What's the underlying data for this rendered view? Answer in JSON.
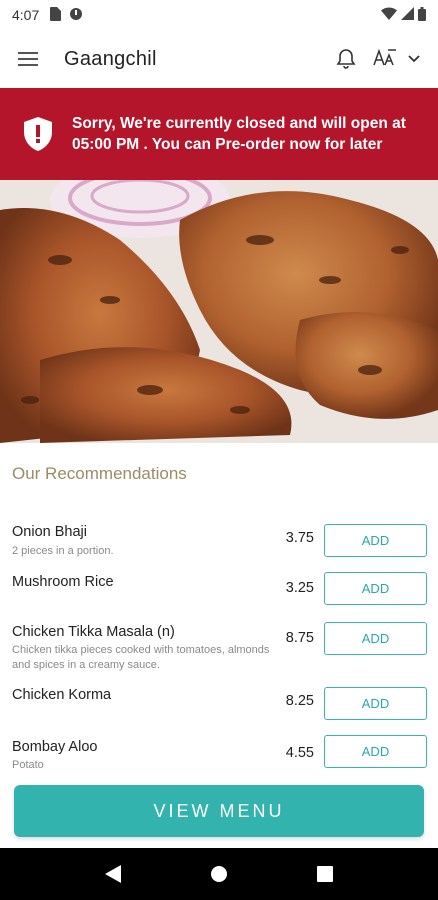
{
  "status_bar": {
    "time": "4:07"
  },
  "app_bar": {
    "title": "Gaangchil"
  },
  "banner": {
    "message": "Sorry, We're currently closed and will open at 05:00 PM . You can Pre-order now for later"
  },
  "recommendations": {
    "title": "Our Recommendations",
    "add_label": "ADD",
    "items": [
      {
        "name": "Onion Bhaji",
        "description": "2 pieces in a portion.",
        "price": "3.75"
      },
      {
        "name": "Mushroom Rice",
        "description": "",
        "price": "3.25"
      },
      {
        "name": "Chicken Tikka Masala (n)",
        "description": "Chicken tikka pieces cooked with tomatoes, almonds and spices in a creamy sauce.",
        "price": "8.75"
      },
      {
        "name": "Chicken Korma",
        "description": "",
        "price": "8.25"
      },
      {
        "name": "Bombay Aloo",
        "description": "Potato",
        "price": "4.55"
      }
    ]
  },
  "view_menu_label": "VIEW MENU",
  "colors": {
    "banner": "#b5152b",
    "accent": "#32b3ae",
    "section_title": "#9b8c67"
  }
}
